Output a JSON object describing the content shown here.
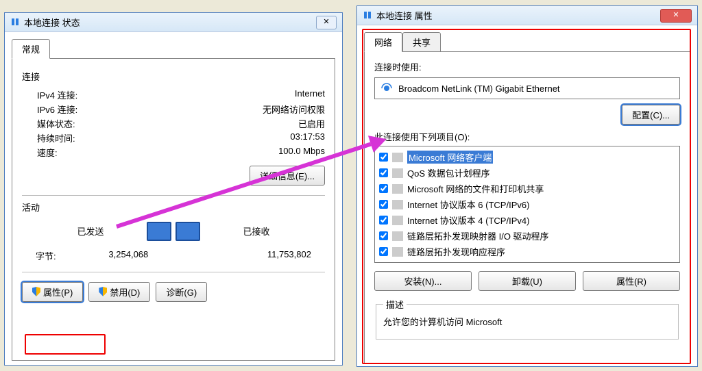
{
  "status": {
    "title": "本地连接 状态",
    "tab_general": "常规",
    "section_connection": "连接",
    "rows": {
      "ipv4_label": "IPv4 连接:",
      "ipv4_value": "Internet",
      "ipv6_label": "IPv6 连接:",
      "ipv6_value": "无网络访问权限",
      "media_label": "媒体状态:",
      "media_value": "已启用",
      "duration_label": "持续时间:",
      "duration_value": "03:17:53",
      "speed_label": "速度:",
      "speed_value": "100.0 Mbps"
    },
    "details_btn": "详细信息(E)...",
    "section_activity": "活动",
    "sent_label": "已发送",
    "recv_label": "已接收",
    "bytes_label": "字节:",
    "bytes_sent": "3,254,068",
    "bytes_recv": "11,753,802",
    "buttons": {
      "properties": "属性(P)",
      "disable": "禁用(D)",
      "diagnose": "诊断(G)"
    }
  },
  "props": {
    "title": "本地连接 属性",
    "tab_network": "网络",
    "tab_share": "共享",
    "connect_using_label": "连接时使用:",
    "adapter": "Broadcom NetLink (TM) Gigabit Ethernet",
    "configure_btn": "配置(C)...",
    "items_label": "此连接使用下列项目(O):",
    "items": [
      {
        "label": "Microsoft 网络客户端",
        "selected": true
      },
      {
        "label": "QoS 数据包计划程序"
      },
      {
        "label": "Microsoft 网络的文件和打印机共享"
      },
      {
        "label": "Internet 协议版本 6 (TCP/IPv6)"
      },
      {
        "label": "Internet 协议版本 4 (TCP/IPv4)"
      },
      {
        "label": "链路层拓扑发现映射器 I/O 驱动程序"
      },
      {
        "label": "链路层拓扑发现响应程序"
      }
    ],
    "install_btn": "安装(N)...",
    "uninstall_btn": "卸载(U)",
    "properties_btn": "属性(R)",
    "description_label": "描述",
    "description_text": "允许您的计算机访问 Microsoft"
  }
}
